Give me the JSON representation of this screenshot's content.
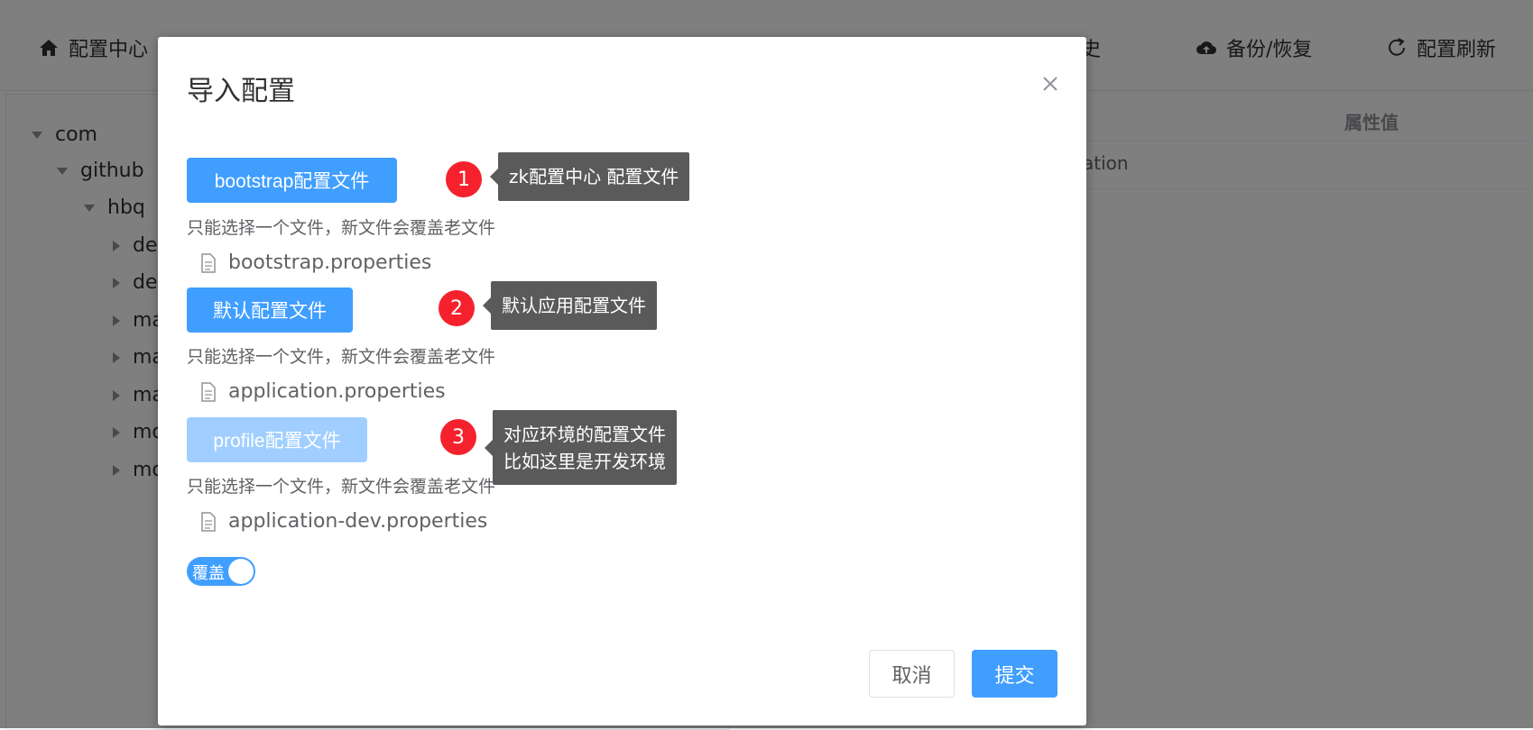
{
  "nav": {
    "home": "配置中心",
    "history": "历史",
    "backup": "备份/恢复",
    "refresh": "配置刷新"
  },
  "tree": {
    "nodes": [
      "com",
      "github",
      "hbq",
      "de",
      "de",
      "ma",
      "ma",
      "ma",
      "mo",
      "mo"
    ]
  },
  "table": {
    "header_value": "属性值",
    "row_text": "ation"
  },
  "dialog": {
    "title": "导入配置",
    "sections": [
      {
        "button": "bootstrap配置文件",
        "tip": "只能选择一个文件，新文件会覆盖老文件",
        "file": "bootstrap.properties",
        "badge": "1",
        "callout_lines": [
          "zk配置中心 配置文件"
        ]
      },
      {
        "button": "默认配置文件",
        "tip": "只能选择一个文件，新文件会覆盖老文件",
        "file": "application.properties",
        "badge": "2",
        "callout_lines": [
          "默认应用配置文件"
        ]
      },
      {
        "button": "profile配置文件",
        "tip": "只能选择一个文件，新文件会覆盖老文件",
        "file": "application-dev.properties",
        "badge": "3",
        "callout_lines": [
          "对应环境的配置文件",
          "比如这里是开发环境"
        ]
      }
    ],
    "switch_label": "覆盖",
    "switch_on": true,
    "cancel": "取消",
    "submit": "提交"
  },
  "colors": {
    "primary": "#409eff",
    "primary_disabled": "#a0cfff",
    "badge": "#f5222d",
    "callout": "#5a5a5a"
  }
}
